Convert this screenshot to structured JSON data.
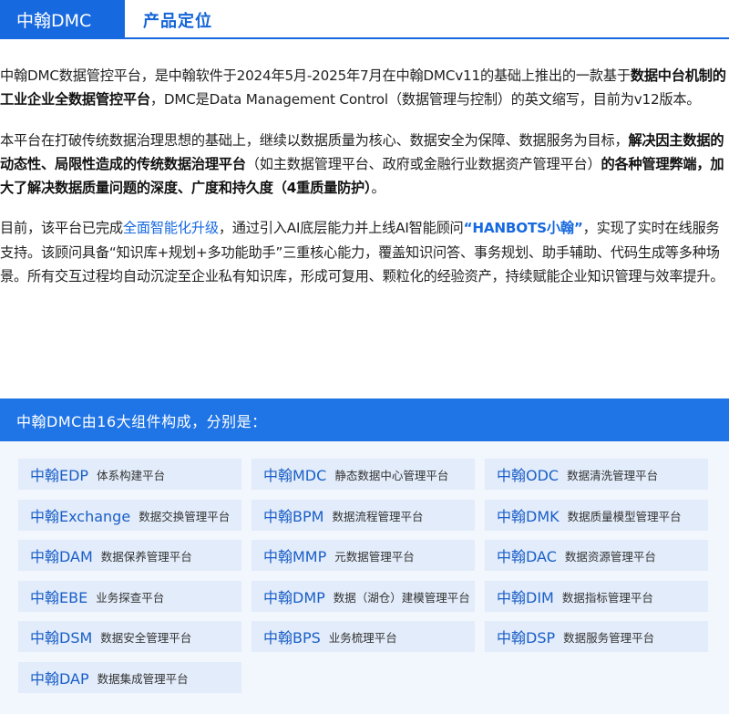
{
  "header": {
    "brand": "中翰DMC",
    "section_title": "产品定位"
  },
  "paragraphs": {
    "p1": {
      "t1": "中翰DMC数据管控平台，是中翰软件于2024年5月-2025年7月在中翰DMCv11的基础上推出的一款基于",
      "b1": "数据中台机制的工业企业全数据管控平台",
      "t2": "，DMC是Data Management Control（数据管理与控制）的英文缩写，目前为v12版本。"
    },
    "p2": {
      "t1": "本平台在打破传统数据治理思想的基础上，继续以数据质量为核心、数据安全为保障、数据服务为目标，",
      "b1": "解决因主数据的动态性、局限性造成的传统数据治理平台",
      "t2": "（如主数据管理平台、政府或金融行业数据资产管理平台）",
      "b2": "的各种管理弊端，加大了解决数据质量问题的深度、广度和持久度（4重质量防护）",
      "t3": "。"
    },
    "p3": {
      "t1": "目前，该平台已完成",
      "link1": "全面智能化升级",
      "t2": "，通过引入AI底层能力并上线AI智能顾问",
      "strong1": "“HANBOTS小翰”",
      "t3": "，实现了实时在线服务支持。该顾问具备“知识库+规划+多功能助手”三重核心能力，覆盖知识问答、事务规划、助手辅助、代码生成等多种场景。所有交互过程均自动沉淀至企业私有知识库，形成可复用、颗粒化的经验资产，持续赋能企业知识管理与效率提升。"
    }
  },
  "components": {
    "heading": "中翰DMC由16大组件构成，分别是：",
    "items": [
      {
        "code": "中翰EDP",
        "desc": "体系构建平台"
      },
      {
        "code": "中翰MDC",
        "desc": "静态数据中心管理平台"
      },
      {
        "code": "中翰ODC",
        "desc": "数据清洗管理平台"
      },
      {
        "code": "中翰Exchange",
        "desc": "数据交换管理平台"
      },
      {
        "code": "中翰BPM",
        "desc": "数据流程管理平台"
      },
      {
        "code": "中翰DMK",
        "desc": "数据质量模型管理平台"
      },
      {
        "code": "中翰DAM",
        "desc": "数据保养管理平台"
      },
      {
        "code": "中翰MMP",
        "desc": "元数据管理平台"
      },
      {
        "code": "中翰DAC",
        "desc": "数据资源管理平台"
      },
      {
        "code": "中翰EBE",
        "desc": "业务探查平台"
      },
      {
        "code": "中翰DMP",
        "desc": "数据（湖仓）建模管理平台"
      },
      {
        "code": "中翰DIM",
        "desc": "数据指标管理平台"
      },
      {
        "code": "中翰DSM",
        "desc": "数据安全管理平台"
      },
      {
        "code": "中翰BPS",
        "desc": "业务梳理平台"
      },
      {
        "code": "中翰DSP",
        "desc": "数据服务管理平台"
      },
      {
        "code": "中翰DAP",
        "desc": "数据集成管理平台"
      }
    ]
  },
  "colors": {
    "brand_blue": "#1769e0",
    "panel_bg": "#f2f6fd",
    "card_bg": "#e3ecfa"
  }
}
